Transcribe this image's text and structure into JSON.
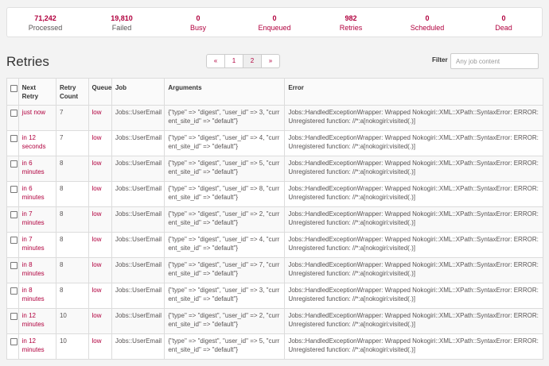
{
  "stats": [
    {
      "value": "71,242",
      "label": "Processed",
      "link": false
    },
    {
      "value": "19,810",
      "label": "Failed",
      "link": false
    },
    {
      "value": "0",
      "label": "Busy",
      "link": true
    },
    {
      "value": "0",
      "label": "Enqueued",
      "link": true
    },
    {
      "value": "982",
      "label": "Retries",
      "link": true
    },
    {
      "value": "0",
      "label": "Scheduled",
      "link": true
    },
    {
      "value": "0",
      "label": "Dead",
      "link": true
    }
  ],
  "page_title": "Retries",
  "pagination": {
    "first": "«",
    "pages": [
      "1",
      "2"
    ],
    "active": "2",
    "last": "»"
  },
  "filter": {
    "label": "Filter",
    "placeholder": "Any job content"
  },
  "table": {
    "headers": [
      "Next Retry",
      "Retry Count",
      "Queue",
      "Job",
      "Arguments",
      "Error"
    ],
    "rows": [
      {
        "next": "just now",
        "count": "7",
        "queue": "low",
        "job": "Jobs::UserEmail",
        "args": "{\"type\" => \"digest\", \"user_id\" => 3, \"current_site_id\" => \"default\"}",
        "error": "Jobs::HandledExceptionWrapper: Wrapped Nokogiri::XML::XPath::SyntaxError: ERROR: Unregistered function: //*:a[nokogiri:visited(.)]"
      },
      {
        "next": "in 12 seconds",
        "count": "7",
        "queue": "low",
        "job": "Jobs::UserEmail",
        "args": "{\"type\" => \"digest\", \"user_id\" => 4, \"current_site_id\" => \"default\"}",
        "error": "Jobs::HandledExceptionWrapper: Wrapped Nokogiri::XML::XPath::SyntaxError: ERROR: Unregistered function: //*:a[nokogiri:visited(.)]"
      },
      {
        "next": "in 6 minutes",
        "count": "8",
        "queue": "low",
        "job": "Jobs::UserEmail",
        "args": "{\"type\" => \"digest\", \"user_id\" => 5, \"current_site_id\" => \"default\"}",
        "error": "Jobs::HandledExceptionWrapper: Wrapped Nokogiri::XML::XPath::SyntaxError: ERROR: Unregistered function: //*:a[nokogiri:visited(.)]"
      },
      {
        "next": "in 6 minutes",
        "count": "8",
        "queue": "low",
        "job": "Jobs::UserEmail",
        "args": "{\"type\" => \"digest\", \"user_id\" => 8, \"current_site_id\" => \"default\"}",
        "error": "Jobs::HandledExceptionWrapper: Wrapped Nokogiri::XML::XPath::SyntaxError: ERROR: Unregistered function: //*:a[nokogiri:visited(.)]"
      },
      {
        "next": "in 7 minutes",
        "count": "8",
        "queue": "low",
        "job": "Jobs::UserEmail",
        "args": "{\"type\" => \"digest\", \"user_id\" => 2, \"current_site_id\" => \"default\"}",
        "error": "Jobs::HandledExceptionWrapper: Wrapped Nokogiri::XML::XPath::SyntaxError: ERROR: Unregistered function: //*:a[nokogiri:visited(.)]"
      },
      {
        "next": "in 7 minutes",
        "count": "8",
        "queue": "low",
        "job": "Jobs::UserEmail",
        "args": "{\"type\" => \"digest\", \"user_id\" => 4, \"current_site_id\" => \"default\"}",
        "error": "Jobs::HandledExceptionWrapper: Wrapped Nokogiri::XML::XPath::SyntaxError: ERROR: Unregistered function: //*:a[nokogiri:visited(.)]"
      },
      {
        "next": "in 8 minutes",
        "count": "8",
        "queue": "low",
        "job": "Jobs::UserEmail",
        "args": "{\"type\" => \"digest\", \"user_id\" => 7, \"current_site_id\" => \"default\"}",
        "error": "Jobs::HandledExceptionWrapper: Wrapped Nokogiri::XML::XPath::SyntaxError: ERROR: Unregistered function: //*:a[nokogiri:visited(.)]"
      },
      {
        "next": "in 8 minutes",
        "count": "8",
        "queue": "low",
        "job": "Jobs::UserEmail",
        "args": "{\"type\" => \"digest\", \"user_id\" => 3, \"current_site_id\" => \"default\"}",
        "error": "Jobs::HandledExceptionWrapper: Wrapped Nokogiri::XML::XPath::SyntaxError: ERROR: Unregistered function: //*:a[nokogiri:visited(.)]"
      },
      {
        "next": "in 12 minutes",
        "count": "10",
        "queue": "low",
        "job": "Jobs::UserEmail",
        "args": "{\"type\" => \"digest\", \"user_id\" => 2, \"current_site_id\" => \"default\"}",
        "error": "Jobs::HandledExceptionWrapper: Wrapped Nokogiri::XML::XPath::SyntaxError: ERROR: Unregistered function: //*:a[nokogiri:visited(.)]"
      },
      {
        "next": "in 12 minutes",
        "count": "10",
        "queue": "low",
        "job": "Jobs::UserEmail",
        "args": "{\"type\" => \"digest\", \"user_id\" => 5, \"current_site_id\" => \"default\"}",
        "error": "Jobs::HandledExceptionWrapper: Wrapped Nokogiri::XML::XPath::SyntaxError: ERROR: Unregistered function: //*:a[nokogiri:visited(.)]"
      }
    ]
  },
  "colors": {
    "accent": "#b1003e",
    "text": "#585454",
    "background": "#f3f3f3"
  }
}
